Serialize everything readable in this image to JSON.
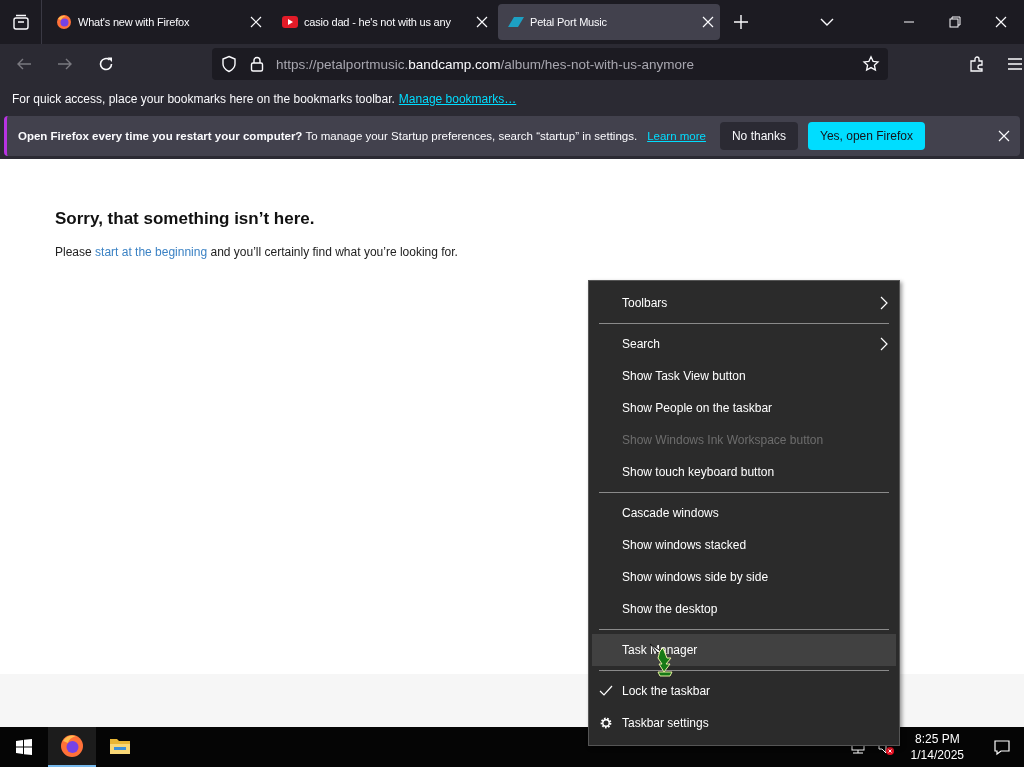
{
  "tabs": [
    {
      "kind": "firefox",
      "title": "What's new with Firefox",
      "selected": false
    },
    {
      "kind": "youtube",
      "title": "casio dad - he's not with us any",
      "selected": false
    },
    {
      "kind": "bandcamp",
      "title": "Petal Port Music",
      "selected": true
    }
  ],
  "address_bar": {
    "url_start": "https://petalportmusic.",
    "url_host": "bandcamp.com",
    "url_path": "/album/hes-not-with-us-anymore"
  },
  "bookmarks_bar": {
    "text": "For quick access, place your bookmarks here on the bookmarks toolbar.",
    "link": "Manage bookmarks…"
  },
  "notification": {
    "message": "**Open Firefox every time you restart your computer?** To manage your Startup preferences, search “startup” in settings.",
    "link": "Learn more",
    "buttons": [
      {
        "label": "No thanks",
        "kind": "secondary"
      },
      {
        "label": "Yes, open Firefox",
        "kind": "primary"
      }
    ]
  },
  "page": {
    "heading": "Sorry, that something isn’t here.",
    "text_before": "Please",
    "link": "start at the beginning",
    "text_after": "and you’ll certainly find what you’re looking for."
  },
  "context_menu": {
    "groups": [
      [
        {
          "kind": "plain",
          "label": "Toolbars",
          "submenu": true,
          "disabled": false,
          "checked": false,
          "selected": false
        }
      ],
      [
        {
          "kind": "plain",
          "label": "Search",
          "submenu": true,
          "disabled": false,
          "checked": false,
          "selected": false
        },
        {
          "kind": "plain",
          "label": "Show Task View button",
          "submenu": false,
          "disabled": false,
          "checked": false,
          "selected": false
        },
        {
          "kind": "plain",
          "label": "Show People on the taskbar",
          "submenu": false,
          "disabled": false,
          "checked": false,
          "selected": false
        },
        {
          "kind": "plain",
          "label": "Show Windows Ink Workspace button",
          "submenu": false,
          "disabled": true,
          "checked": false,
          "selected": false
        },
        {
          "kind": "plain",
          "label": "Show touch keyboard button",
          "submenu": false,
          "disabled": false,
          "checked": false,
          "selected": false
        }
      ],
      [
        {
          "kind": "plain",
          "label": "Cascade windows",
          "submenu": false,
          "disabled": false,
          "checked": false,
          "selected": false
        },
        {
          "kind": "plain",
          "label": "Show windows stacked",
          "submenu": false,
          "disabled": false,
          "checked": false,
          "selected": false
        },
        {
          "kind": "plain",
          "label": "Show windows side by side",
          "submenu": false,
          "disabled": false,
          "checked": false,
          "selected": false
        },
        {
          "kind": "plain",
          "label": "Show the desktop",
          "submenu": false,
          "disabled": false,
          "checked": false,
          "selected": false
        }
      ],
      [
        {
          "kind": "plain",
          "label": "Task Manager",
          "submenu": false,
          "disabled": false,
          "checked": false,
          "selected": true
        }
      ],
      [
        {
          "kind": "plain",
          "label": "Lock the taskbar",
          "submenu": false,
          "disabled": false,
          "checked": true,
          "selected": false
        },
        {
          "kind": "settings",
          "label": "Taskbar settings",
          "submenu": false,
          "disabled": false,
          "checked": false,
          "selected": false
        }
      ]
    ]
  },
  "taskbar": {
    "apps": [
      {
        "kind": "firefox",
        "selected": true
      },
      {
        "kind": "explorer",
        "selected": false
      }
    ],
    "time": "8:25 PM",
    "date": "1/14/2025"
  }
}
